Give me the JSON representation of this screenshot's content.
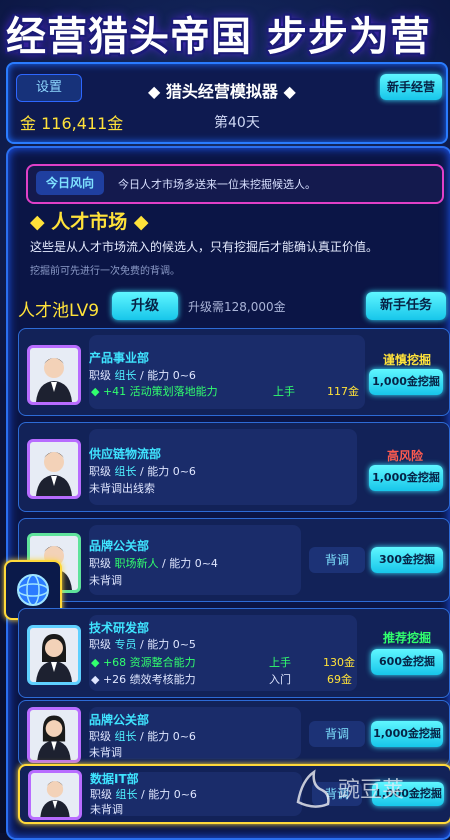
{
  "banner": "经营猎头帝国 步步为营",
  "header": {
    "settings_label": "设置",
    "title": "猎头经营模拟器",
    "newbie_label": "新手经营",
    "gold": "金 116,411金",
    "day": "第40天"
  },
  "trend": {
    "tag": "今日风向",
    "text": "今日人才市场多送来一位未挖掘候选人。"
  },
  "market": {
    "title": "人才市场",
    "desc": "这些是从人才市场流入的候选人，只有挖掘后才能确认真正价值。",
    "note": "挖掘前可先进行一次免费的背调。"
  },
  "pool": {
    "label": "人才池LV9",
    "upgrade": "升级",
    "cost": "升级需128,000金",
    "task": "新手任务"
  },
  "cards": [
    {
      "dept": "产品事业部",
      "rank_pre": "职级 ",
      "rank": "组长",
      "ability": " / 能力 0~6",
      "l1": "+41 活动策划落地能力",
      "l1_tag": "上手",
      "l1_val": "117金",
      "status": "谨慎挖掘",
      "btn": "1,000金挖掘"
    },
    {
      "dept": "供应链物流部",
      "rank_pre": "职级 ",
      "rank": "组长",
      "ability": " / 能力 0~6",
      "l1": "未背调出线索",
      "status": "高风险",
      "btn": "1,000金挖掘"
    },
    {
      "dept": "品牌公关部",
      "rank_pre": "职级 ",
      "rank": "职场新人",
      "ability": " / 能力 0~4",
      "l1": "未背调",
      "bg": "背调",
      "btn": "300金挖掘"
    },
    {
      "dept": "技术研发部",
      "rank_pre": "职级 ",
      "rank": "专员",
      "ability": " / 能力 0~5",
      "l1": "+68 资源整合能力",
      "l1_tag": "上手",
      "l1_val": "130金",
      "l2": "+26 绩效考核能力",
      "l2_tag": "入门",
      "l2_val": "69金",
      "status": "推荐挖掘",
      "btn": "600金挖掘"
    },
    {
      "dept": "品牌公关部",
      "rank_pre": "职级 ",
      "rank": "组长",
      "ability": " / 能力 0~6",
      "l1": "未背调",
      "bg": "背调",
      "btn": "1,000金挖掘"
    },
    {
      "dept": "数据IT部",
      "rank_pre": "职级 ",
      "rank": "组长",
      "ability": " / 能力 0~6",
      "l1": "未背调",
      "bg": "背调",
      "btn": "1,000金挖掘"
    }
  ],
  "watermark": "豌豆荚",
  "colors": {
    "cyan": "#3fe4ff",
    "green": "#31ff6e",
    "yellow": "#ffe23a",
    "magenta": "#e040c8",
    "risk": "#ff5b4f"
  }
}
